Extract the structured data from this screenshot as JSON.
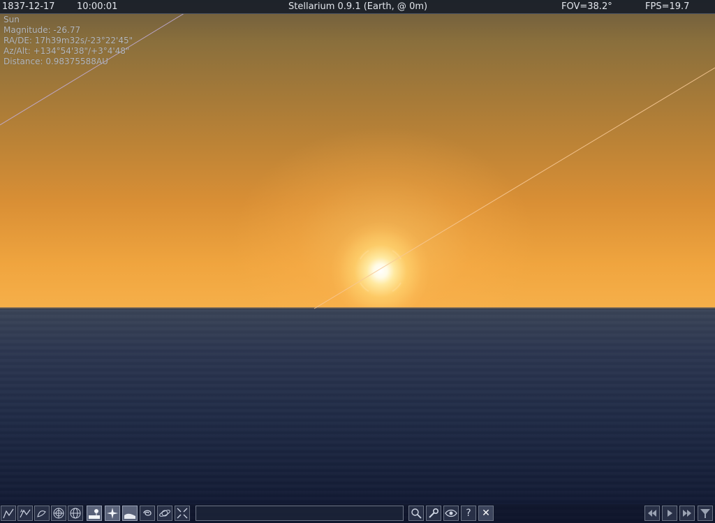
{
  "topbar": {
    "date": "1837-12-17",
    "time": "10:00:01",
    "title": "Stellarium 0.9.1 (Earth,  @ 0m)",
    "fov": "FOV=38.2°",
    "fps": "FPS=19.7"
  },
  "object_info": {
    "name": "Sun",
    "magnitude": "Magnitude: -26.77",
    "ra_de": "RA/DE: 17h39m32s/-23°22'45\"",
    "az_alt": "Az/Alt: +134°54'38\"/+3°4'48\"",
    "distance": "Distance: 0.98375588AU"
  },
  "colors": {
    "sky_top": "#6b5b3e",
    "sky_horizon": "#f6b04a",
    "ocean": "#1f2a45",
    "line_upper_left": "#b9a6d6",
    "line_ecliptic": "#f6c38a"
  },
  "toolbar": {
    "left_buttons": [
      {
        "icon": "constellation-lines-icon",
        "active": false
      },
      {
        "icon": "constellation-names-icon",
        "active": false
      },
      {
        "icon": "constellation-art-icon",
        "active": false
      },
      {
        "icon": "azimuthal-grid-icon",
        "active": false
      },
      {
        "icon": "equatorial-grid-icon",
        "active": false
      },
      {
        "icon": "ground-icon",
        "active": true
      },
      {
        "icon": "cardinal-points-icon",
        "active": true
      },
      {
        "icon": "atmosphere-icon",
        "active": true
      },
      {
        "icon": "nebulae-icon",
        "active": false
      },
      {
        "icon": "planets-hints-icon",
        "active": false
      },
      {
        "icon": "goto-selected-icon",
        "active": false
      }
    ],
    "right_buttons": [
      {
        "icon": "search-icon",
        "label": ""
      },
      {
        "icon": "config-icon",
        "label": ""
      },
      {
        "icon": "view-icon",
        "label": ""
      },
      {
        "icon": "help-icon",
        "label": "?"
      },
      {
        "icon": "quit-icon",
        "label": "✕"
      }
    ],
    "time_buttons": [
      {
        "icon": "rewind-icon"
      },
      {
        "icon": "play-icon"
      },
      {
        "icon": "fast-forward-icon"
      },
      {
        "icon": "filter-icon"
      }
    ]
  }
}
